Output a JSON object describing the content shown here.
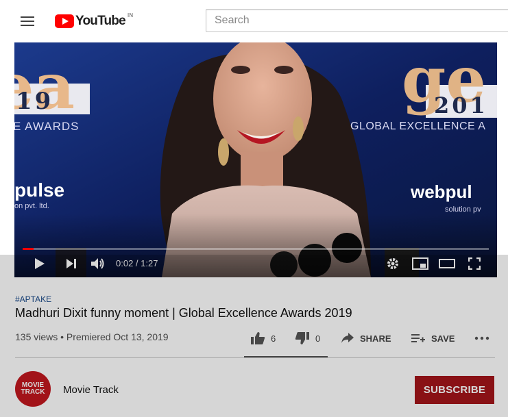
{
  "header": {
    "logo_text": "YouTube",
    "logo_region": "IN",
    "search_placeholder": "Search"
  },
  "player": {
    "current_time": "0:02",
    "duration": "1:27",
    "time_display": "0:02 / 1:27",
    "progress_fraction": 0.023,
    "backdrop": {
      "left_big": "ea",
      "left_year": "19",
      "left_awards": "E AWARDS",
      "left_pulse": "pulse",
      "left_pvt": "on pvt. ltd.",
      "right_big": "ge",
      "right_year": "201",
      "right_awards": "GLOBAL EXCELLENCE A",
      "right_web": "webpul",
      "right_sol": "solution pv"
    }
  },
  "video": {
    "hashtag": "#APTAKE",
    "title": "Madhuri Dixit funny moment | Global Excellence Awards 2019",
    "meta": "135 views • Premiered Oct 13, 2019",
    "like_count": "6",
    "dislike_count": "0",
    "share_label": "SHARE",
    "save_label": "SAVE",
    "like_fraction": 1.0
  },
  "channel": {
    "name": "Movie Track",
    "avatar_line1": "MOVIE",
    "avatar_line2": "TRACK",
    "subscribe_label": "SUBSCRIBE"
  },
  "colors": {
    "brand_red": "#ff0000",
    "subscribe_bg": "#a4151a",
    "hashtag": "#1a4a8a"
  },
  "icons": [
    "menu-icon",
    "play-icon",
    "next-icon",
    "volume-icon",
    "settings-icon",
    "miniplayer-icon",
    "theater-icon",
    "fullscreen-icon",
    "like-icon",
    "dislike-icon",
    "share-icon",
    "save-playlist-icon",
    "more-icon"
  ]
}
